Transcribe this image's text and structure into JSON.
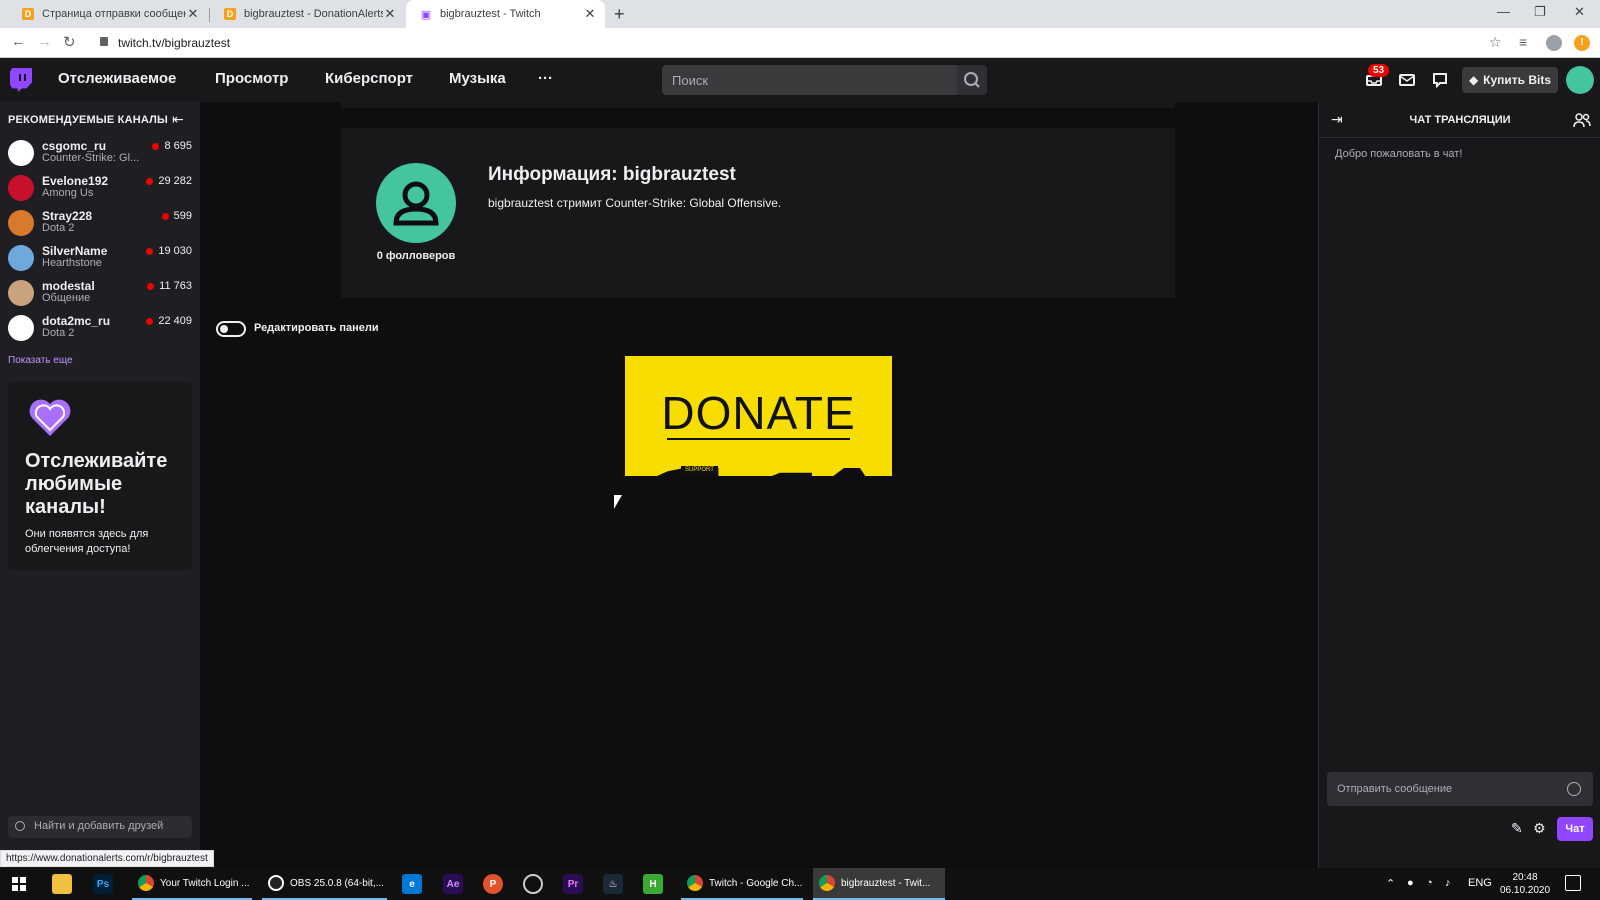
{
  "browser": {
    "tabs": [
      {
        "title": "Страница отправки сообщений",
        "favicon": "donationalerts-icon"
      },
      {
        "title": "bigbrauztest - DonationAlerts",
        "favicon": "donationalerts-icon"
      },
      {
        "title": "bigbrauztest - Twitch",
        "favicon": "twitch-icon",
        "active": true
      }
    ],
    "url": "twitch.tv/bigbrauztest",
    "status_url": "https://www.donationalerts.com/r/bigbrauztest"
  },
  "topnav": {
    "links": [
      "Отслеживаемое",
      "Просмотр",
      "Киберспорт",
      "Музыка"
    ],
    "more": "···",
    "search_placeholder": "Поиск",
    "notification_count": "53",
    "buy_bits": "Купить Bits"
  },
  "sidebar": {
    "header": "РЕКОМЕНДУЕМЫЕ КАНАЛЫ",
    "channels": [
      {
        "name": "csgomc_ru",
        "game": "Counter-Strike: Gl...",
        "viewers": "8 695",
        "avatar_color": "#ffffff"
      },
      {
        "name": "Evelone192",
        "game": "Among Us",
        "viewers": "29 282",
        "avatar_color": "#c8102e"
      },
      {
        "name": "Stray228",
        "game": "Dota 2",
        "viewers": "599",
        "avatar_color": "#d97a2b"
      },
      {
        "name": "SilverName",
        "game": "Hearthstone",
        "viewers": "19 030",
        "avatar_color": "#6fa8dc"
      },
      {
        "name": "modestal",
        "game": "Общение",
        "viewers": "11 763",
        "avatar_color": "#c9a27e"
      },
      {
        "name": "dota2mc_ru",
        "game": "Dota 2",
        "viewers": "22 409",
        "avatar_color": "#ffffff"
      }
    ],
    "show_more": "Показать еще",
    "promo_title": "Отслеживайте любимые каналы!",
    "promo_text": "Они появятся здесь для облегчения доступа!",
    "friend_search": "Найти и добавить друзей"
  },
  "main": {
    "about_title": "Информация: bigbrauztest",
    "about_desc": "bigbrauztest стримит Counter-Strike: Global Offensive.",
    "followers": "0 фолловеров",
    "edit_panels": "Редактировать панели",
    "donate_text": "DONATE",
    "donate_sub": "SUPPORT"
  },
  "chat": {
    "title": "ЧАТ ТРАНСЛЯЦИИ",
    "welcome": "Добро пожаловать в чат!",
    "input_placeholder": "Отправить сообщение",
    "send": "Чат"
  },
  "taskbar": {
    "apps": [
      {
        "label": "Your Twitch Login ...",
        "icon": "chrome-icon"
      },
      {
        "label": "OBS 25.0.8 (64-bit,...",
        "icon": "obs-icon"
      },
      {
        "label": "Twitch - Google Ch...",
        "icon": "chrome-icon"
      },
      {
        "label": "bigbrauztest - Twit...",
        "icon": "chrome-icon",
        "active": true
      }
    ],
    "pinned": [
      "Ps",
      "Ae",
      "P",
      "Pr",
      "H"
    ],
    "lang": "ENG",
    "time": "20:48",
    "date": "06.10.2020"
  },
  "colors": {
    "twitch_purple": "#9147ff",
    "live_red": "#eb0400",
    "donate_yellow": "#f8dd00",
    "avatar_green": "#45c4a0"
  }
}
